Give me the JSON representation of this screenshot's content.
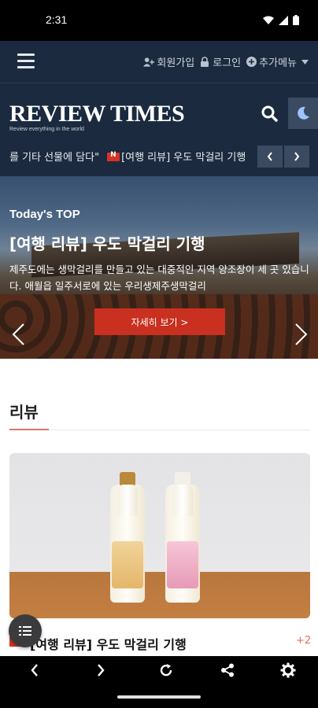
{
  "status": {
    "time": "2:31"
  },
  "nav": {
    "signup": "회원가입",
    "login": "로그인",
    "more": "추가메뉴"
  },
  "header": {
    "logo_title": "REVIEW TIMES",
    "logo_sub": "Review everything in the world"
  },
  "ticker": {
    "prev_text": "를 기타 선물에 담다\"",
    "current_text": "[여행 리뷰] 우도 막걸리 기행"
  },
  "hero": {
    "label": "Today's TOP",
    "title": "[여행 리뷰] 우도 막걸리 기행",
    "description": "제주도에는 생막걸리를 만들고 있는 대중적인 지역 양조장이 세 곳 있습니다. 애월읍 일주서로에 있는 우리생제주생막걸리",
    "button": "자세히 보기 >"
  },
  "section": {
    "title": "리뷰"
  },
  "card": {
    "title": "[여행 리뷰] 우도 막걸리 기행",
    "count": "+2"
  },
  "colors": {
    "navy": "#1b2a3e",
    "accent": "#c9301f",
    "badge": "#d63326"
  }
}
